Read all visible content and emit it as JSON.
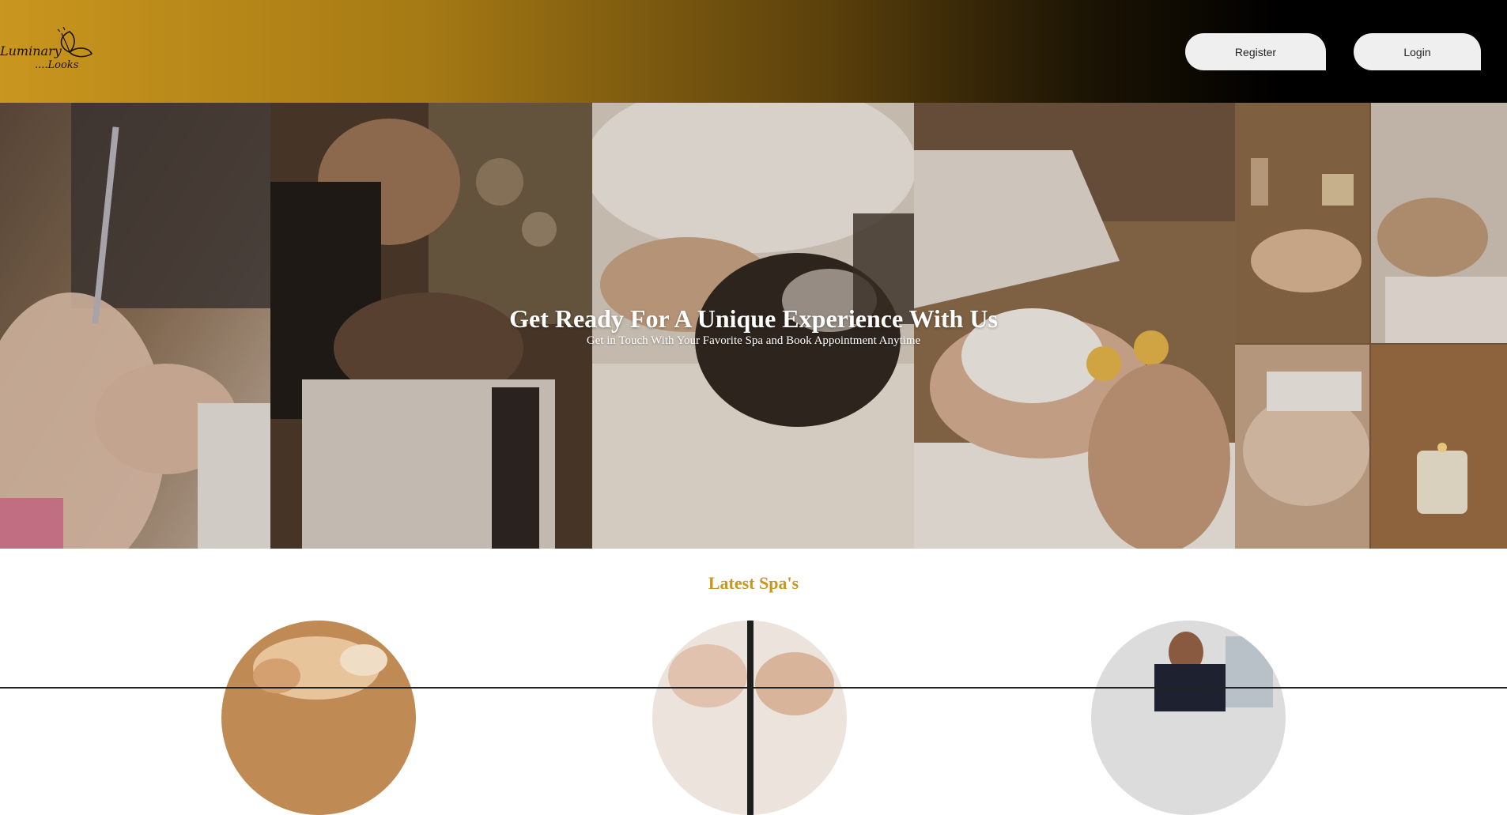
{
  "header": {
    "logo_text_line1": "Luminary",
    "logo_text_line2": "....Looks",
    "register_label": "Register",
    "login_label": "Login"
  },
  "hero": {
    "title": "Get Ready For A Unique Experience With Us",
    "subtitle": "Get in Touch With Your Favorite Spa and Book Appointment Anytime"
  },
  "latest": {
    "title": "Latest Spa's"
  },
  "colors": {
    "accent": "#c9961e",
    "header_dark": "#000000",
    "button_bg": "#efefef"
  }
}
